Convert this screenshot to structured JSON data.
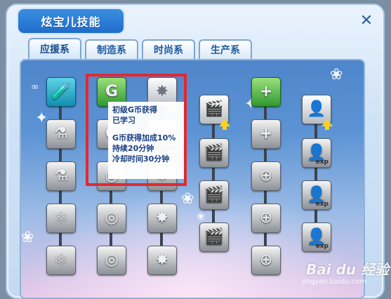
{
  "window": {
    "title": "炫宝儿技能"
  },
  "tabs": [
    {
      "label": "应援系",
      "active": true
    },
    {
      "label": "制造系",
      "active": false
    },
    {
      "label": "时尚系",
      "active": false
    },
    {
      "label": "生产系",
      "active": false
    }
  ],
  "tooltip": {
    "name": "初级G币获得",
    "status": "已学习",
    "effect": "G币获得加成10%",
    "duration": "持续20分钟",
    "cooldown": "冷却时间30分钟"
  },
  "icons": {
    "g_coin": "G",
    "exp": "exp",
    "plus": "+"
  },
  "colors": {
    "highlight": "#e4282e",
    "tooltip_text": "#1a3f80",
    "title_bg": "#2a7fd6"
  },
  "watermark": {
    "brand": "Bai du 经验",
    "url": "jingyan.baidu.com"
  }
}
